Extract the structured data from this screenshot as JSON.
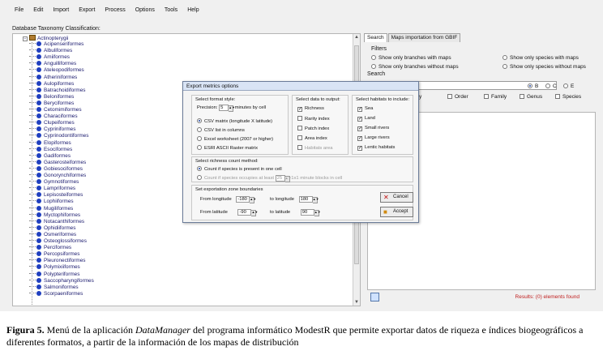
{
  "menu": [
    "File",
    "Edit",
    "Import",
    "Export",
    "Process",
    "Options",
    "Tools",
    "Help"
  ],
  "tree": {
    "label": "Database Taxonomy Classification:",
    "root": "Actinopterygii",
    "items": [
      "Acipenseriformes",
      "Albuliformes",
      "Amiiformes",
      "Anguilliformes",
      "Ateleopodiformes",
      "Atheriniformes",
      "Aulopiformes",
      "Batrachoidiformes",
      "Beloniformes",
      "Beryciformes",
      "Cetomimiformes",
      "Characiformes",
      "Clupeiformes",
      "Cypriniformes",
      "Cyprinodontiformes",
      "Elopiformes",
      "Esociformes",
      "Gadiformes",
      "Gasterosteiformes",
      "Gobiesociformes",
      "Gonorynchiformes",
      "Gymnotiformes",
      "Lampriformes",
      "Lepisosteiformes",
      "Lophiiformes",
      "Mugiliformes",
      "Myctophiformes",
      "Notacanthiformes",
      "Ophidiiformes",
      "Osmeriformes",
      "Osteoglossiformes",
      "Perciformes",
      "Percopsiformes",
      "Pleuronectiformes",
      "Polymixiiformes",
      "Polypteriformes",
      "Saccopharyngiformes",
      "Salmoniformes",
      "Scorpaeniformes"
    ]
  },
  "right": {
    "tabs": [
      "Search",
      "Maps importation from GBIF"
    ],
    "filters_title": "Filters",
    "filters": [
      "Show only branches with maps",
      "Show only species with maps",
      "Show only branches without maps",
      "Show only species without maps"
    ],
    "search_title": "Search",
    "radios": [
      "B",
      "C",
      "E"
    ],
    "levels": [
      "y",
      "Order",
      "Family",
      "Genus",
      "Species"
    ],
    "results_text": "Results: (0) elements found"
  },
  "dialog": {
    "title": "Export metrics  options",
    "format": {
      "title": "Select format style:",
      "precision_label": "Precision:",
      "precision_value": "5",
      "precision_unit": "minutes by cell",
      "options": [
        "CSV matrix (longitude X latitude)",
        "CSV list in columns",
        "Excel worksheet (2007 or higher)",
        "ESRI ASCII Raster matrix"
      ]
    },
    "data": {
      "title": "Select data to output:",
      "options": [
        "Richness",
        "Rarity index",
        "Patch index",
        "Area index",
        "Habitats area"
      ]
    },
    "habitats": {
      "title": "Select habitats to include:",
      "options": [
        "Sea",
        "Land",
        "Small rivers",
        "Large rivers",
        "Lentic habitats"
      ]
    },
    "method": {
      "title": "Select richness count method:",
      "opt1": "Count if species is present in one cell",
      "opt2": "Count if species occupies at least",
      "opt2_value": "25",
      "opt2_unit": "1x1 minute blocks in cell"
    },
    "bounds": {
      "title": "Set exportation zone boundaries",
      "from_lon_label": "From longitude",
      "from_lon": "-180",
      "to_lon_label": "to longitude",
      "to_lon": "180",
      "from_lat_label": "From latitude",
      "from_lat": "-90",
      "to_lat_label": "to latitude",
      "to_lat": "90"
    },
    "cancel": "Cancel",
    "accept": "Accept"
  },
  "caption": {
    "label": "Figura 5.",
    "text1": " Menú de la aplicación ",
    "app": "DataManager",
    "text2": " del programa informático ModestR que permite exportar datos de riqueza e índices biogeográficos a diferentes formatos, a partir de la información de los mapas de distribución"
  }
}
